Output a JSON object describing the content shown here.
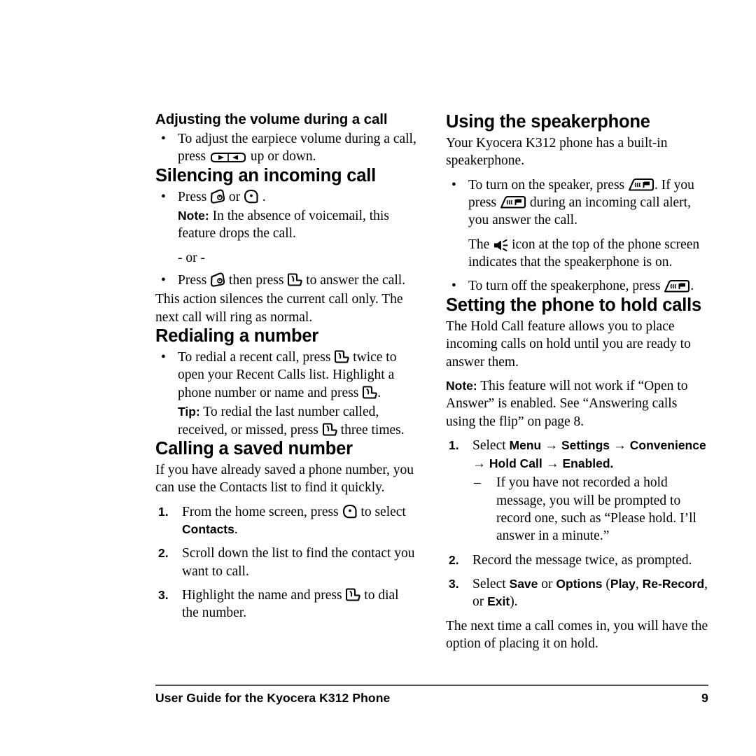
{
  "document": {
    "footer_text": "User Guide for the Kyocera K312 Phone",
    "page_number": "9"
  },
  "icons": {
    "volume_key": "volume-rocker-key-icon",
    "end_key": "end-power-key-icon",
    "ok_key": "ok-select-key-icon",
    "send_key": "send-talk-key-icon",
    "speaker_key": "speakerphone-key-icon",
    "speaker_indicator": "speaker-on-indicator-icon"
  },
  "left_column": {
    "section_volume": {
      "heading": "Adjusting the volume during a call",
      "bullet_1_pre": "To adjust the earpiece volume during a call, press",
      "bullet_1_post": "up or down."
    },
    "section_silencing": {
      "heading": "Silencing an incoming call",
      "bullet_1_pre": "Press",
      "bullet_1_mid": "or",
      "bullet_1_post": ".",
      "note_label": "Note:",
      "note_text": "In the absence of voicemail, this feature drops the call.",
      "or_separator": "- or -",
      "bullet_2_pre": "Press",
      "bullet_2_mid": "then press",
      "bullet_2_post": "to answer the call.",
      "trailing_paragraph": "This action silences the current call only. The next call will ring as normal."
    },
    "section_redialing": {
      "heading": "Redialing a number",
      "bullet_1_pre": "To redial a recent call, press",
      "bullet_1_mid": "twice to open your Recent Calls list. Highlight a phone number or name and press",
      "bullet_1_post": ".",
      "tip_label": "Tip:",
      "tip_pre": "To redial the last number called, received, or missed, press",
      "tip_post": "three times."
    },
    "section_calling_saved": {
      "heading": "Calling a saved number",
      "intro": "If you have already saved a phone number, you can use the Contacts list to find it quickly.",
      "steps": [
        {
          "num": "1.",
          "pre": "From the home screen, press",
          "mid": "to select",
          "ui": "Contacts",
          "post": "."
        },
        {
          "num": "2.",
          "text": "Scroll down the list to find the contact you want to call."
        },
        {
          "num": "3.",
          "pre": "Highlight the name and press",
          "post": "to dial the number."
        }
      ]
    }
  },
  "right_column": {
    "section_speakerphone": {
      "heading": "Using the speakerphone",
      "intro": "Your Kyocera K312 phone has a built-in speakerphone.",
      "bullet_1_pre": "To turn on the speaker, press",
      "bullet_1_mid": ". If you press",
      "bullet_1_post": "during an incoming call alert, you answer the call.",
      "indicator_pre": "The",
      "indicator_post": "icon at the top of the phone screen indicates that the speakerphone is on.",
      "bullet_2_pre": "To turn off the speakerphone, press",
      "bullet_2_post": "."
    },
    "section_hold_calls": {
      "heading": "Setting the phone to hold calls",
      "intro": "The Hold Call feature allows you to place incoming calls on hold until you are ready to answer them.",
      "note_label": "Note:",
      "note_text": "This feature will not work if “Open to Answer” is enabled. See “Answering calls using the flip” on page 8.",
      "step_1": {
        "num": "1.",
        "select": "Select",
        "menu": "Menu",
        "arrow_1": "→",
        "settings": "Settings",
        "arrow_2": "→",
        "convenience": "Convenience",
        "arrow_3": "→",
        "hold_call": "Hold Call",
        "arrow_4": "→",
        "enabled": "Enabled."
      },
      "step_1_sub": {
        "dash": "–",
        "text": "If you have not recorded a hold message, you will be prompted to record one, such as “Please hold. I’ll answer in a minute.”"
      },
      "step_2": {
        "num": "2.",
        "text": "Record the message twice, as prompted."
      },
      "step_3": {
        "num": "3.",
        "select": "Select",
        "save": "Save",
        "or_1": "or",
        "options": "Options",
        "paren_open": "(",
        "play": "Play",
        "comma": ",",
        "rerecord": "Re-Record",
        "comma_2": ",",
        "or_2": "or",
        "exit": "Exit",
        "paren_close": ")."
      },
      "closing": "The next time a call comes in, you will have the option of placing it on hold."
    }
  }
}
